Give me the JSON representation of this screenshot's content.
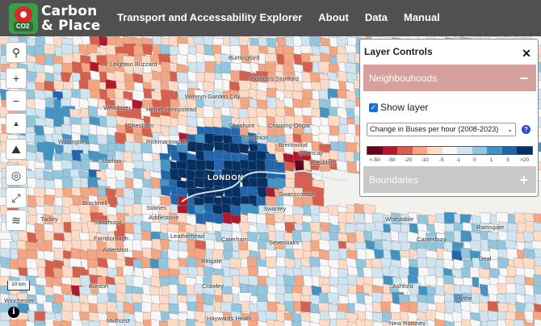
{
  "header": {
    "logo_line1": "Carbon",
    "logo_line2": "& Place",
    "logo_badge": "CO2",
    "nav": [
      "Transport and Accessability Explorer",
      "About",
      "Data",
      "Manual"
    ]
  },
  "colors": {
    "header_bg": "#505050",
    "panel_neighbourhoods": "#d6a09c",
    "panel_boundaries": "#c8c8c8",
    "legend": [
      "#67001f",
      "#b2182b",
      "#d6604d",
      "#f4a582",
      "#fddbc7",
      "#f7f7f7",
      "#d1e5f0",
      "#92c5de",
      "#4393c3",
      "#2166ac",
      "#053061"
    ]
  },
  "toolbar": {
    "icons": [
      "search-icon",
      "zoom-in-icon",
      "zoom-out-icon",
      "north-arrow-icon",
      "terrain-icon",
      "locate-icon",
      "fullscreen-icon",
      "layers-icon"
    ],
    "symbols": [
      "⚲",
      "+",
      "−",
      "▲",
      "⛰",
      "◎",
      "⤢",
      "≋"
    ]
  },
  "scale": "10 km",
  "info": "i",
  "layer_controls": {
    "title": "Layer Controls",
    "close": "✕",
    "neighbourhoods": {
      "label": "Neighbouhoods",
      "sign": "−"
    },
    "show_layer": "Show layer",
    "selected_option": "Change in Buses per hour (2008-2023)",
    "help": "?",
    "legend_labels": [
      "<-50",
      "-50",
      "-20",
      "-10",
      "-5",
      "-1",
      "0",
      "1",
      "5",
      ">20"
    ],
    "boundaries": {
      "label": "Boundaries",
      "sign": "+"
    }
  },
  "map_labels": {
    "london": "LONDON",
    "towns": [
      "Leighton Buzzard",
      "Buntingford",
      "Bishop's Stortford",
      "Hemel Hempstead",
      "Welwyn Garden City",
      "Wendover",
      "Chesham",
      "Cheshunt",
      "Chipping Ongar",
      "Rickmansworth",
      "Loughton",
      "Watlington",
      "Marlow",
      "Brentwood",
      "Billericay",
      "Basildon",
      "Bracknell",
      "Staines",
      "Addlestone",
      "Swanscombe",
      "Swanley",
      "Tadley",
      "Sandhurst",
      "Leatherhead",
      "Sevenoaks",
      "Farnborough",
      "Aldershot",
      "Caterham",
      "Reigate",
      "Whitstable",
      "Canterbury",
      "Ramsgate",
      "Crawley",
      "Bordon",
      "Deal",
      "Ashford",
      "Winchester",
      "Hythe",
      "Midhurst",
      "Haywards Heath",
      "New Romney"
    ]
  }
}
